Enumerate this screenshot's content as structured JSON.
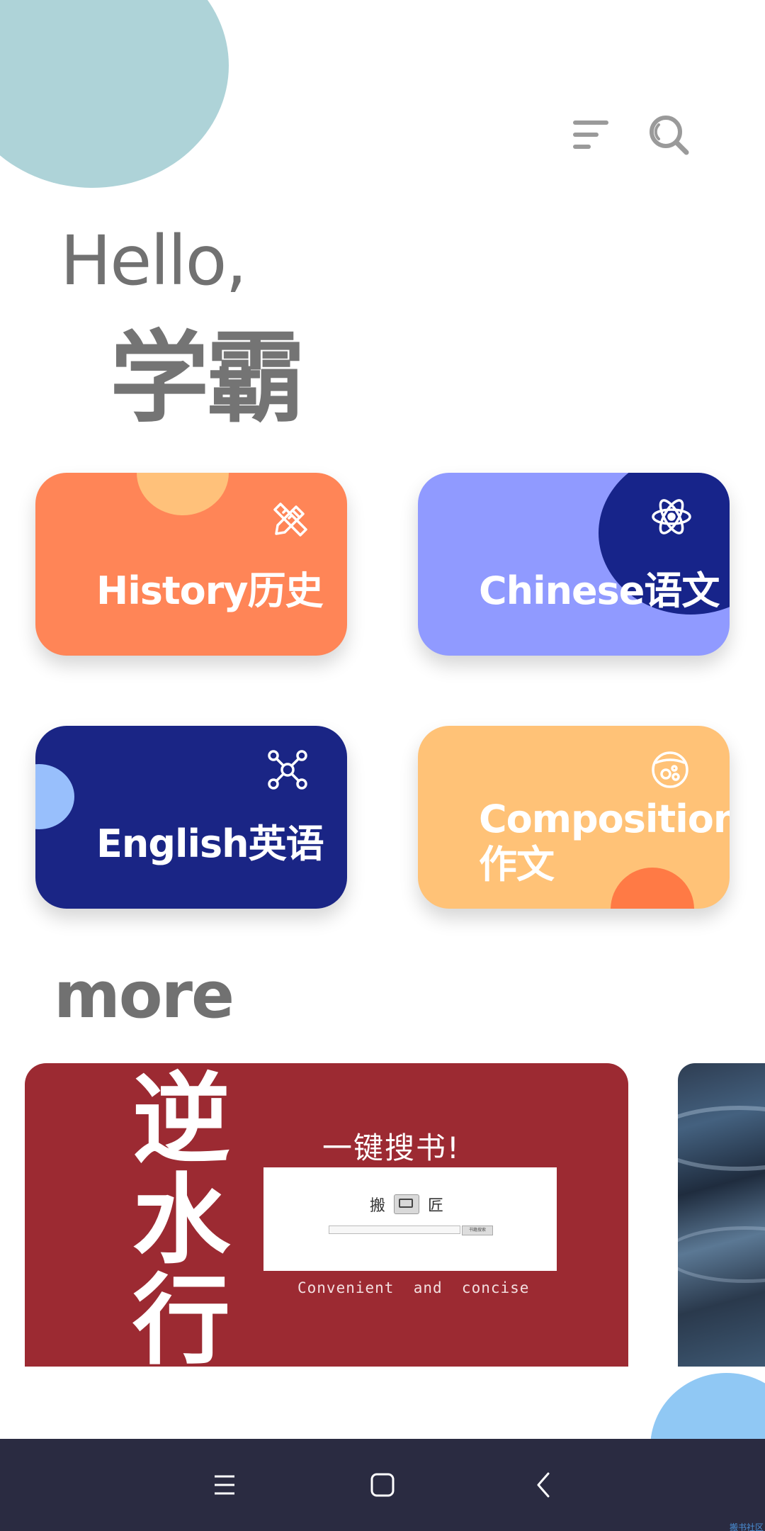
{
  "header": {
    "menu_icon": "menu-icon",
    "search_icon": "search-icon"
  },
  "greeting": {
    "hello": "Hello,",
    "name": "学霸"
  },
  "subjects": [
    {
      "label": "History历史",
      "icon": "pencil-ruler-icon",
      "color": "#ff8557"
    },
    {
      "label": "Chinese语文",
      "icon": "atom-icon",
      "color": "#909aff"
    },
    {
      "label": "English英语",
      "icon": "molecule-icon",
      "color": "#1a2585"
    },
    {
      "label": "Composition作文",
      "icon": "flask-icon",
      "color": "#ffc277"
    }
  ],
  "more": {
    "title": "more",
    "banner": {
      "vertical_title": [
        "逆",
        "水",
        "行"
      ],
      "tagline": "一键搜书!",
      "app_name_left": "搬",
      "app_name_right": "匠",
      "search_button": "书籍搜索",
      "footer": "Convenient  and  concise"
    }
  },
  "navbar": {
    "recents_icon": "recents-icon",
    "home_icon": "home-icon",
    "back_icon": "back-icon"
  },
  "watermark": "搬书社区"
}
